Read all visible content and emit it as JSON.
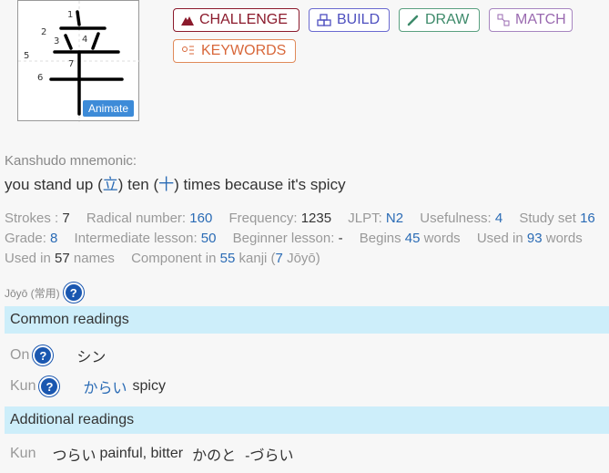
{
  "kanji": {
    "char": "辛",
    "stroke_numbers": [
      "1",
      "2",
      "3",
      "4",
      "5",
      "6",
      "7"
    ],
    "animate_label": "Animate"
  },
  "toolbar": {
    "challenge": "CHALLENGE",
    "build": "BUILD",
    "draw": "DRAW",
    "match": "MATCH",
    "keywords": "KEYWORDS"
  },
  "mnemonic": {
    "label": "Kanshudo mnemonic:",
    "part1": "you stand up (",
    "comp1": "立",
    "part2": ") ten (",
    "comp2": "十",
    "part3": ") times because it's spicy"
  },
  "stats": {
    "strokes_label": "Strokes :",
    "strokes": "7",
    "radical_label": "Radical number:",
    "radical": "160",
    "frequency_label": "Frequency:",
    "frequency": "1235",
    "jlpt_label": "JLPT:",
    "jlpt": "N2",
    "usefulness_label": "Usefulness:",
    "usefulness": "4",
    "studyset_label": "Study set",
    "studyset": "16",
    "grade_label": "Grade:",
    "grade": "8",
    "intermediate_label": "Intermediate lesson:",
    "intermediate": "50",
    "beginner_label": "Beginner lesson:",
    "beginner": "-",
    "begins_label": "Begins",
    "begins": "45",
    "begins_suffix": "words",
    "usedin_label": "Used in",
    "usedin": "93",
    "usedin_suffix": "words",
    "usednames_label": "Used in",
    "usednames": "57",
    "usednames_suffix": "names",
    "component_label": "Component in",
    "component": "55",
    "component_mid": "kanji (",
    "component_joyo": "7",
    "component_suffix": "Jōyō)"
  },
  "joyo": {
    "label": "Jōyō (常用)",
    "help": "?"
  },
  "common": {
    "title": "Common readings",
    "on_label": "On",
    "on_reading": "シン",
    "kun_label": "Kun",
    "kun_reading": "からい",
    "kun_gloss": "spicy"
  },
  "additional": {
    "title": "Additional readings",
    "kun_label": "Kun",
    "r1": "つらい",
    "r1_gloss": "painful, bitter",
    "r2": "かのと",
    "r3": "-づらい"
  }
}
